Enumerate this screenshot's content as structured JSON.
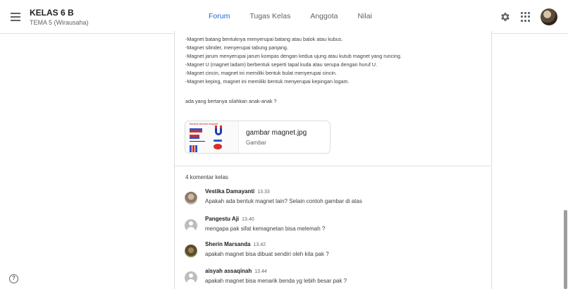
{
  "header": {
    "class_name": "KELAS 6 B",
    "class_subtitle": "TEMA 5 (Wirausaha)",
    "tabs": [
      {
        "label": "Forum",
        "active": true
      },
      {
        "label": "Tugas Kelas",
        "active": false
      },
      {
        "label": "Anggota",
        "active": false
      },
      {
        "label": "Nilai",
        "active": false
      }
    ],
    "icons": [
      "menu-icon",
      "gear-icon",
      "apps-grid-icon",
      "user-avatar"
    ]
  },
  "post": {
    "lines": [
      "-Magnet batang bentuknya menyerupai batang atau balok atau kubus.",
      "-Magnet silinder, menyerupai tabung panjang.",
      "-Magnet jarum menyerupai jarum kompas dengan kedua ujung atau kutub magnet yang runcing.",
      "-Magnet U (magnet ladam) berbentuk seperti tapal kuda atau serupa dengan huruf U.",
      "-Magnet cincin, magnet ini memiliki bentuk bulat menyerupai cincin.",
      "-Magnet keping, magnet ini memiliki bentuk menyerupai kepingan logam."
    ],
    "question": "ada yang bertanya silahkan anak-anak ?",
    "attachment": {
      "thumbnail_title": "Bentuk-bentuk magnet",
      "name": "gambar magnet.jpg",
      "type": "Gambar"
    }
  },
  "comments": {
    "count_label": "4 komentar kelas",
    "items": [
      {
        "author": "Vestika Damayanti",
        "time": "13.33",
        "text": "Apakah ada bentuk magnet lain? Selain contoh gambar di atas",
        "avatar": "photo1"
      },
      {
        "author": "Pangestu Aji",
        "time": "13.40",
        "text": "mengapa pak sifat kemagnetan bisa melemah ?",
        "avatar": "generic"
      },
      {
        "author": "Sherin Marsanda",
        "time": "13.42",
        "text": "apakah magnet bisa dibuat sendiri oleh kita pak ?",
        "avatar": "photo2"
      },
      {
        "author": "aisyah assaqinah",
        "time": "13.44",
        "text": "apakah magnet bisa menarik benda yg lebih besar pak ?",
        "avatar": "generic"
      }
    ]
  },
  "colors": {
    "accent": "#1967d2",
    "text": "#3c4043",
    "divider": "#e0e0e0"
  }
}
